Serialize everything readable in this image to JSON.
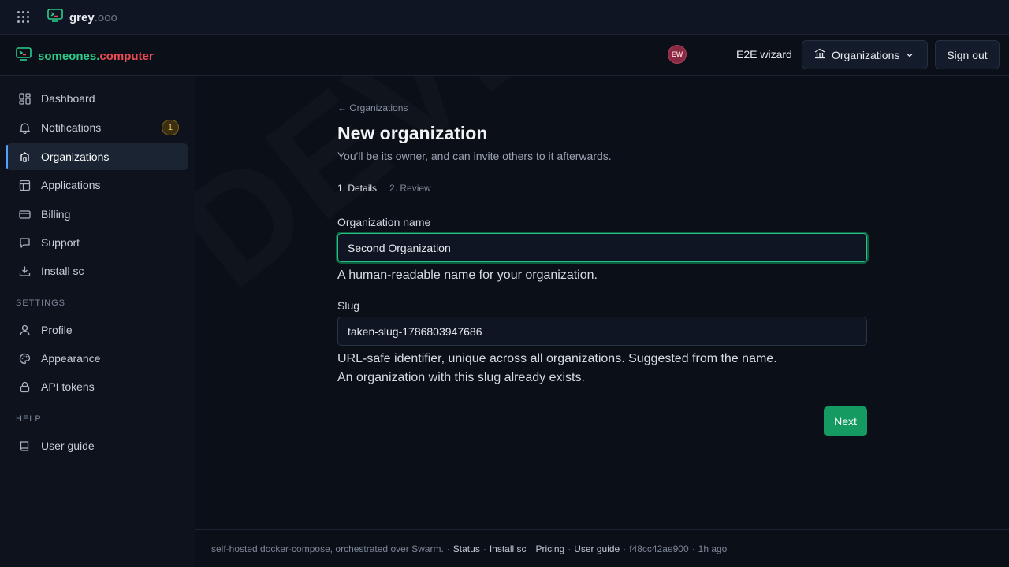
{
  "topbar": {
    "brand_bold": "grey",
    "brand_light": ".ooo"
  },
  "header": {
    "site_brand_part1": "someones",
    "site_brand_dot": ".",
    "site_brand_part2": "computer",
    "avatar_initials": "EW",
    "user_name": "E2E wizard",
    "org_button_label": "Organizations",
    "signout_label": "Sign out"
  },
  "sidebar": {
    "items": [
      {
        "label": "Dashboard"
      },
      {
        "label": "Notifications",
        "badge": "1"
      },
      {
        "label": "Organizations"
      },
      {
        "label": "Applications"
      },
      {
        "label": "Billing"
      },
      {
        "label": "Support"
      },
      {
        "label": "Install sc"
      }
    ],
    "settings_label": "SETTINGS",
    "settings_items": [
      {
        "label": "Profile"
      },
      {
        "label": "Appearance"
      },
      {
        "label": "API tokens"
      }
    ],
    "help_label": "HELP",
    "help_items": [
      {
        "label": "User guide"
      }
    ]
  },
  "main": {
    "back_link": "← Organizations",
    "title": "New organization",
    "subtitle": "You'll be its owner, and can invite others to it afterwards.",
    "step1": "1. Details",
    "step2": "2. Review",
    "org_name_label": "Organization name",
    "org_name_value": "Second Organization",
    "org_name_help": "A human-readable name for your organization.",
    "slug_label": "Slug",
    "slug_value": "taken-slug-1786803947686",
    "slug_help": "URL-safe identifier, unique across all organizations. Suggested from the name.",
    "slug_error": "An organization with this slug already exists.",
    "next_label": "Next",
    "watermark": "DEVELOPMENT"
  },
  "footer": {
    "text": "self-hosted docker-compose, orchestrated over Swarm.",
    "links": [
      "Status",
      "Install sc",
      "Pricing",
      "User guide"
    ],
    "commit": "f48cc42ae900",
    "age": "1h ago",
    "separator": "·"
  },
  "colors": {
    "accent": "#2ecc8a",
    "brand_red": "#ef4b55",
    "primary_button": "#159a62"
  }
}
